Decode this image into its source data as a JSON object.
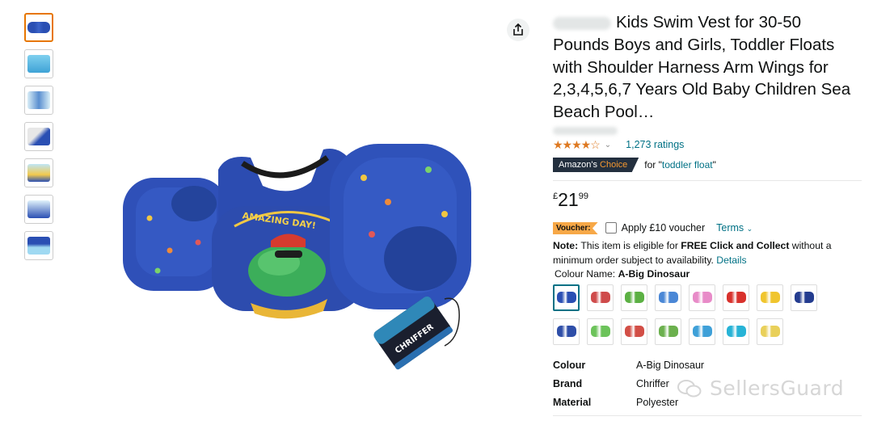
{
  "title": "Kids Swim Vest for 30-50 Pounds Boys and Girls, Toddler Floats with Shoulder Harness Arm Wings for 2,3,4,5,6,7 Years Old Baby Children Sea Beach Pool…",
  "rating": {
    "stars": 4.5,
    "ratings_text": "1,273 ratings"
  },
  "choice": {
    "amazon": "Amazon's ",
    "choice": "Choice",
    "for": "for \"",
    "keyword": "toddler float",
    "close_quote": "\""
  },
  "price": {
    "currency": "£",
    "whole": "21",
    "fraction": "99"
  },
  "voucher": {
    "badge": "Voucher:",
    "label": "Apply £10 voucher",
    "terms": "Terms"
  },
  "note": {
    "prefix": "Note:",
    "text1": " This item is eligible for ",
    "bold": "FREE Click and Collect",
    "text2": " without a minimum order subject to availability. ",
    "details": "Details"
  },
  "colour": {
    "label": "Colour Name: ",
    "value": "A-Big Dinosaur"
  },
  "swatch_colors": [
    "#2a4fb3",
    "#cf4b4b",
    "#5bb043",
    "#4a87d6",
    "#e88bc8",
    "#d8312c",
    "#f0c52e",
    "#243c8f",
    "#2e4ea8",
    "#6cc35a",
    "#d24e46",
    "#6bb04d",
    "#3ea0d8",
    "#27b3d6",
    "#e9d05a"
  ],
  "specs": [
    {
      "key": "Colour",
      "value": "A-Big Dinosaur"
    },
    {
      "key": "Brand",
      "value": "Chriffer"
    },
    {
      "key": "Material",
      "value": "Polyester"
    }
  ],
  "product_image": {
    "headline": "AMAZING DAY!",
    "bag_brand": "CHRIFFER"
  },
  "watermark": "SellersGuard"
}
